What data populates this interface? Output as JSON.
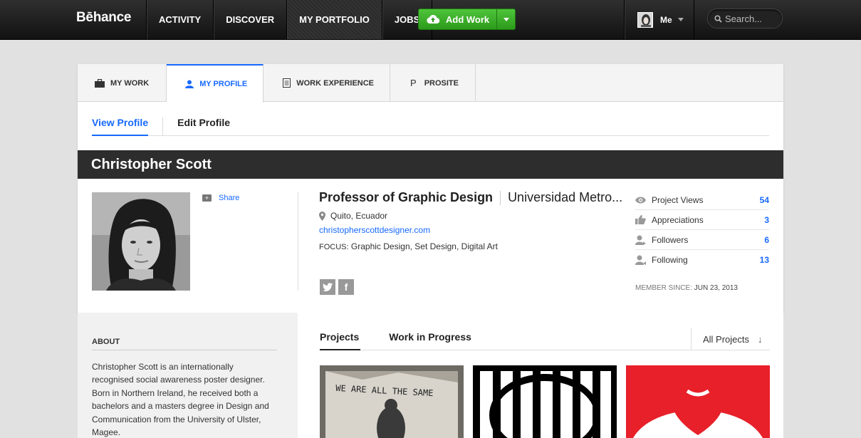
{
  "topbar": {
    "logo": "Bēhance",
    "nav": [
      {
        "label": "ACTIVITY",
        "active": false
      },
      {
        "label": "DISCOVER",
        "active": false
      },
      {
        "label": "MY PORTFOLIO",
        "active": true
      },
      {
        "label": "JOBS",
        "active": false
      }
    ],
    "add_work_label": "Add Work",
    "user_label": "Me",
    "search_placeholder": "Search..."
  },
  "profile_tabs": [
    {
      "label": "MY WORK",
      "icon": "briefcase-icon",
      "active": false
    },
    {
      "label": "MY PROFILE",
      "icon": "person-icon",
      "active": true
    },
    {
      "label": "WORK EXPERIENCE",
      "icon": "document-icon",
      "active": false
    },
    {
      "label": "PROSITE",
      "icon": "prosite-p-icon",
      "active": false
    }
  ],
  "subtabs": {
    "view": "View Profile",
    "edit": "Edit Profile"
  },
  "profile": {
    "name": "Christopher Scott",
    "share_label": "Share",
    "title": "Professor of Graphic Design",
    "organization": "Universidad Metro...",
    "location": "Quito, Ecuador",
    "website": "christopherscottdesigner.com",
    "focus_label": "FOCUS:",
    "focus_value": "Graphic Design, Set Design, Digital Art",
    "member_since_label": "MEMBER SINCE:",
    "member_since_value": "JUN 23, 2013"
  },
  "stats": [
    {
      "label": "Project Views",
      "value": "54",
      "icon": "eye-icon"
    },
    {
      "label": "Appreciations",
      "value": "3",
      "icon": "thumbs-up-icon"
    },
    {
      "label": "Followers",
      "value": "6",
      "icon": "followers-icon"
    },
    {
      "label": "Following",
      "value": "13",
      "icon": "following-icon"
    }
  ],
  "about": {
    "heading": "ABOUT",
    "text": "Christopher Scott is an internationally recognised social awareness poster designer. Born in Northern Ireland, he received both a bachelors and a masters degree in Design and Communication from the University of Ulster, Magee."
  },
  "projects": {
    "tabs": [
      "Projects",
      "Work in Progress"
    ],
    "filter_label": "All Projects",
    "thumb1_text": "WE ARE ALL THE SAME"
  },
  "colors": {
    "accent": "#1769ff",
    "green": "#3bb22a",
    "namebar": "#2d2d2d"
  }
}
